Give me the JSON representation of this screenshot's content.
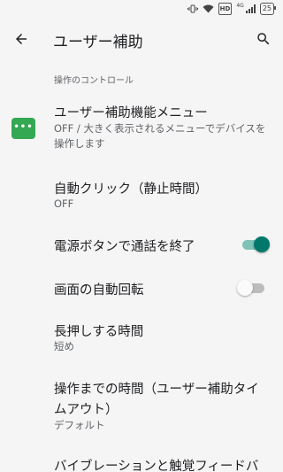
{
  "status_bar": {
    "hd_label": "HD",
    "network_label": "4G",
    "battery_level": "25"
  },
  "app_bar": {
    "title": "ユーザー補助"
  },
  "section": {
    "header": "操作のコントロール"
  },
  "items": [
    {
      "title": "ユーザー補助機能メニュー",
      "subtitle": "OFF / 大きく表示されるメニューでデバイスを操作します",
      "icon": "menu-dots-icon",
      "icon_color": "#34a853"
    },
    {
      "title": "自動クリック（静止時間）",
      "subtitle": "OFF"
    },
    {
      "title": "電源ボタンで通話を終了",
      "toggle": true
    },
    {
      "title": "画面の自動回転",
      "toggle": false
    },
    {
      "title": "長押しする時間",
      "subtitle": "短め"
    },
    {
      "title": "操作までの時間（ユーザー補助タイムアウト）",
      "title_line1": "操作までの時間（ユーザー補助タイ",
      "title_line2": "ムアウト）",
      "subtitle": "デフォルト"
    },
    {
      "title": "バイブレーションと触覚フィードバ"
    }
  ],
  "colors": {
    "accent": "#00796b",
    "background": "#f5f5f5"
  }
}
